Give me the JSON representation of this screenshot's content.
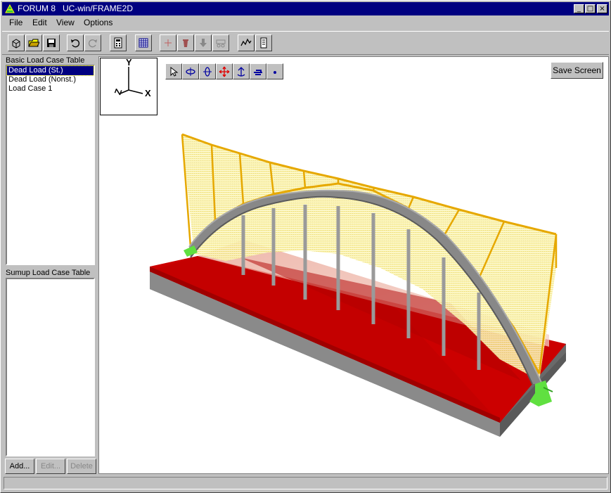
{
  "window": {
    "title": "FORUM 8   UC-win/FRAME2D",
    "controls": {
      "minimize": "_",
      "maximize": "□",
      "close": "×"
    }
  },
  "menu": {
    "items": [
      "File",
      "Edit",
      "View",
      "Options"
    ]
  },
  "toolbar": {
    "icons": [
      "cube-icon",
      "open-folder-icon",
      "save-disk-icon",
      "undo-icon",
      "redo-icon",
      "calculator-sheet-icon",
      "grid-table-icon",
      "add-node-icon",
      "delete-member-icon",
      "load-arrow-icon",
      "support-icon",
      "member-force-icon",
      "report-icon"
    ]
  },
  "left_panel": {
    "basic_label": "Basic Load Case Table",
    "basic_items": [
      "Dead Load (St.)",
      "Dead Load (Nonst.)",
      "Load Case 1"
    ],
    "selected_index": 0,
    "sumup_label": "Sumup Load Case Table",
    "sumup_items": [],
    "buttons": {
      "add": "Add...",
      "edit": "Edit...",
      "delete": "Delete"
    }
  },
  "viewport": {
    "save_label": "Save Screen",
    "axes": {
      "y": "Y",
      "z": "Z",
      "x": "X"
    },
    "view_tools": [
      "select-arrow-icon",
      "rotate-x-icon",
      "rotate-y-icon",
      "pan-icon",
      "zoom-icon",
      "view-side-icon",
      "point-icon"
    ],
    "colors": {
      "deck": "#cc0000",
      "base": "#808080",
      "arch": "#8a8a8a",
      "load": "#f0c020",
      "support": "#60e040"
    }
  },
  "statusbar": {
    "text": ""
  }
}
